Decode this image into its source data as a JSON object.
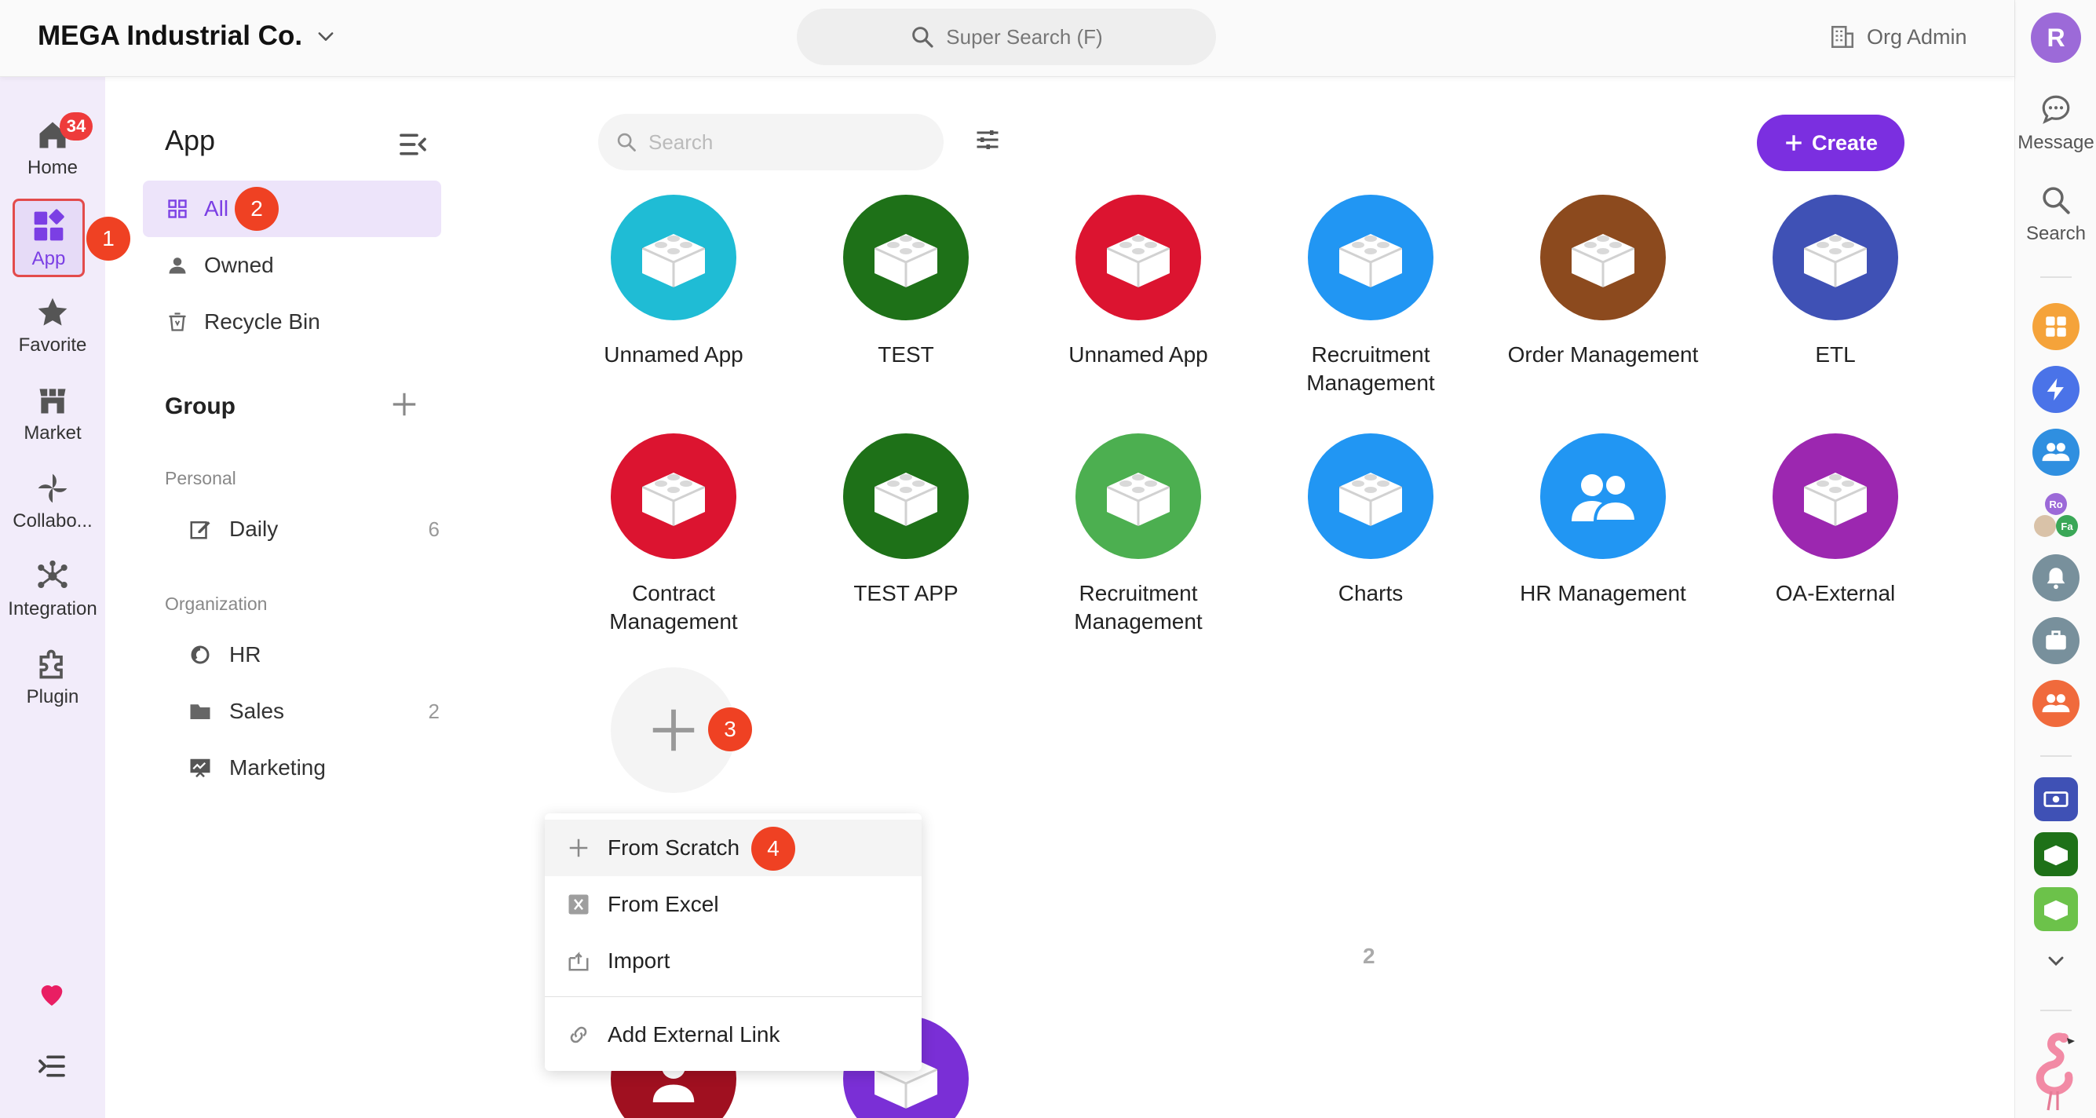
{
  "topbar": {
    "org_name": "MEGA Industrial Co.",
    "super_search": "Super Search (F)",
    "org_admin": "Org Admin"
  },
  "leftnav": {
    "items": [
      {
        "label": "Home",
        "icon": "home-icon"
      },
      {
        "label": "App",
        "icon": "app-icon"
      },
      {
        "label": "Favorite",
        "icon": "star-icon"
      },
      {
        "label": "Market",
        "icon": "market-icon"
      },
      {
        "label": "Collabo...",
        "icon": "pinwheel-icon"
      },
      {
        "label": "Integration",
        "icon": "integration-icon"
      },
      {
        "label": "Plugin",
        "icon": "plugin-icon"
      }
    ],
    "home_badge": "34"
  },
  "steps": [
    "1",
    "2",
    "3",
    "4"
  ],
  "panel": {
    "title": "App",
    "items": [
      {
        "label": "All"
      },
      {
        "label": "Owned"
      },
      {
        "label": "Recycle Bin"
      }
    ],
    "group_title": "Group",
    "personal_label": "Personal",
    "personal": [
      {
        "label": "Daily",
        "count": "6"
      }
    ],
    "organization_label": "Organization",
    "organization": [
      {
        "label": "HR",
        "count": ""
      },
      {
        "label": "Sales",
        "count": "2"
      },
      {
        "label": "Marketing",
        "count": ""
      }
    ]
  },
  "main": {
    "search_placeholder": "Search",
    "create_label": "Create",
    "apps": [
      {
        "name": "Unnamed App",
        "color": "#1fbcd5",
        "icon": "lego-brick-icon"
      },
      {
        "name": "TEST",
        "color": "#1e7118",
        "icon": "lego-brick-icon"
      },
      {
        "name": "Unnamed App",
        "color": "#dc1430",
        "icon": "lego-brick-icon"
      },
      {
        "name": "Recruitment Management",
        "color": "#2196f3",
        "icon": "lego-brick-icon"
      },
      {
        "name": "Order Management",
        "color": "#8c4a1e",
        "icon": "lego-brick-icon"
      },
      {
        "name": "ETL",
        "color": "#3f51b5",
        "icon": "lego-brick-icon"
      },
      {
        "name": "Contract Management",
        "color": "#dc1430",
        "icon": "lego-brick-icon"
      },
      {
        "name": "TEST APP",
        "color": "#1e7118",
        "icon": "lego-brick-icon"
      },
      {
        "name": "Recruitment Management",
        "color": "#4caf50",
        "icon": "lego-brick-icon"
      },
      {
        "name": "Charts",
        "color": "#2196f3",
        "icon": "lego-brick-icon"
      },
      {
        "name": "HR Management",
        "color": "#2196f3",
        "icon": "people-icon"
      },
      {
        "name": "OA-External",
        "color": "#9c27b0",
        "icon": "lego-brick-icon"
      }
    ],
    "partial_apps": [
      {
        "color": "#a01020",
        "icon": "person-icon"
      },
      {
        "color": "#7a2fd6",
        "icon": "lego-brick-icon"
      }
    ],
    "behind_menu_count": "2"
  },
  "create_menu": {
    "items": [
      {
        "label": "From Scratch",
        "icon": "plus-icon"
      },
      {
        "label": "From Excel",
        "icon": "excel-icon"
      },
      {
        "label": "Import",
        "icon": "import-icon"
      },
      {
        "label": "Add External Link",
        "icon": "link-icon"
      }
    ]
  },
  "rightrail": {
    "avatar_letter": "R",
    "message_label": "Message",
    "search_label": "Search",
    "mini_avatars": [
      "Ro",
      "Fa"
    ]
  },
  "colors": {
    "accent": "#7b2fe0",
    "step_badge": "#ef4123",
    "nav_bg": "#f2ecfa"
  }
}
